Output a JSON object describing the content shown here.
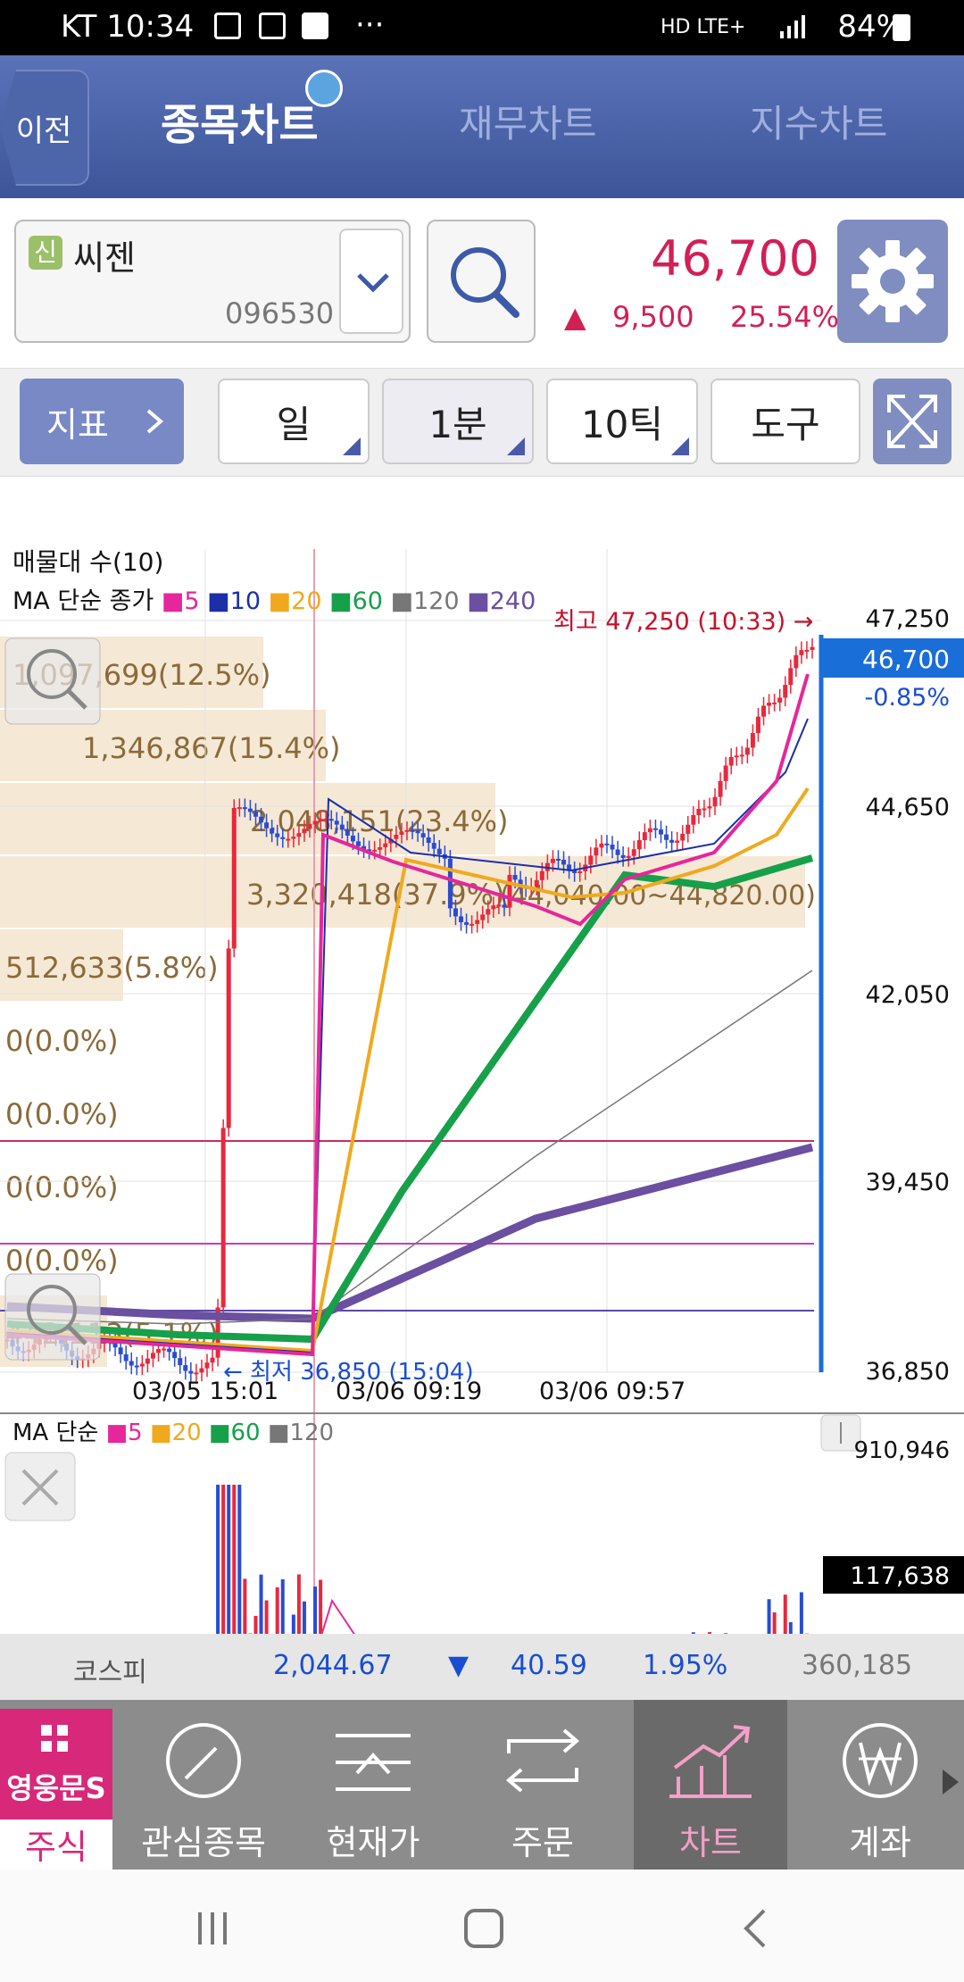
{
  "status": {
    "carrier_time": "KT 10:34",
    "dots": "···",
    "net": "HD LTE+",
    "battery": "84%"
  },
  "header": {
    "back_label": "이전",
    "tabs": [
      {
        "label": "종목차트"
      },
      {
        "label": "재무차트"
      },
      {
        "label": "지수차트"
      }
    ]
  },
  "stock": {
    "badge": "신",
    "name": "씨젠",
    "code": "096530",
    "price": "46,700",
    "change_arrow": "▲",
    "change": "9,500",
    "change_pct": "25.54%"
  },
  "toolbar": {
    "indicator_label": "지표",
    "period_label": "일",
    "minute_label": "1분",
    "tick_label": "10틱",
    "tools_label": "도구"
  },
  "chart_data": [
    {
      "type": "line",
      "title": "매물대 수(10)",
      "legend_prefix": "MA 단순 종가",
      "legend": [
        {
          "name": "5",
          "color": "#e6269b"
        },
        {
          "name": "10",
          "color": "#1b2fa8"
        },
        {
          "name": "20",
          "color": "#f0a91e"
        },
        {
          "name": "60",
          "color": "#16a04a"
        },
        {
          "name": "120",
          "color": "#777777"
        },
        {
          "name": "240",
          "color": "#6b4fa0"
        }
      ],
      "y_ticks": [
        "47,250",
        "46,700",
        "-0.85%",
        "44,650",
        "42,050",
        "39,450",
        "36,850"
      ],
      "current_price": "46,700",
      "current_change": "-0.85%",
      "x_ticks": [
        "03/05 15:01",
        "03/06 09:19",
        "03/06 09:57"
      ],
      "high_label": "최고 47,250 (10:33) →",
      "low_label": "← 최저 36,850 (15:04)",
      "volume_profile": [
        "1,097,699(12.5%)",
        "1,346,867(15.4%)",
        "2,048,151(23.4%)",
        "3,320,418(37.9%)",
        "(44,040.00~44,820.00)",
        "512,633(5.8%)",
        "0(0.0%)",
        "0(0.0%)",
        "0(0.0%)",
        "0(0.0%)",
        "442,113(5.1%)"
      ],
      "ylim": [
        36850,
        47250
      ]
    },
    {
      "type": "bar",
      "title": "MA 단순",
      "legend": [
        {
          "name": "5",
          "color": "#e6269b"
        },
        {
          "name": "20",
          "color": "#f0a91e"
        },
        {
          "name": "60",
          "color": "#16a04a"
        },
        {
          "name": "120",
          "color": "#777777"
        }
      ],
      "y_ticks": [
        "910,946",
        "117,638"
      ]
    }
  ],
  "kospi": {
    "label": "코스피",
    "value": "2,044.67",
    "arrow": "▼",
    "change": "40.59",
    "pct": "1.95%",
    "volume": "360,185"
  },
  "bottom_nav": [
    {
      "label": "주식",
      "logo": "영웅문S"
    },
    {
      "label": "관심종목"
    },
    {
      "label": "현재가"
    },
    {
      "label": "주문"
    },
    {
      "label": "차트"
    },
    {
      "label": "계좌"
    }
  ]
}
